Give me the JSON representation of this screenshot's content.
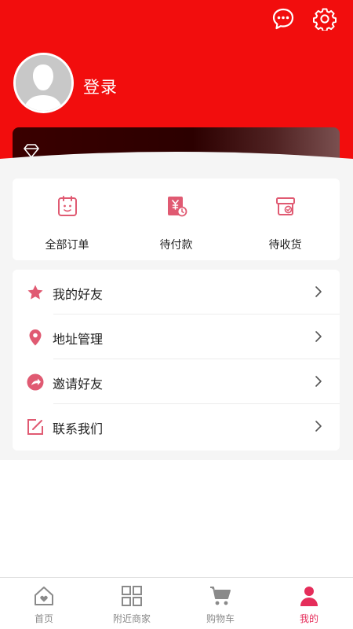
{
  "header": {
    "login_label": "登录",
    "message_icon": "chat-bubble-icon",
    "settings_icon": "gear-icon",
    "avatar_icon": "default-user-avatar"
  },
  "vip_card": {
    "icon": "diamond-icon"
  },
  "orders": [
    {
      "label": "全部订单",
      "icon": "clipboard-icon"
    },
    {
      "label": "待付款",
      "icon": "yen-bill-icon"
    },
    {
      "label": "待收货",
      "icon": "parcel-box-icon"
    }
  ],
  "menu": [
    {
      "label": "我的好友",
      "icon": "star-icon"
    },
    {
      "label": "地址管理",
      "icon": "location-pin-icon"
    },
    {
      "label": "邀请好友",
      "icon": "share-arrow-icon"
    },
    {
      "label": "联系我们",
      "icon": "edit-icon"
    }
  ],
  "tabbar": [
    {
      "label": "首页",
      "icon": "home-icon",
      "active": false
    },
    {
      "label": "附近商家",
      "icon": "grid-icon",
      "active": false
    },
    {
      "label": "购物车",
      "icon": "cart-icon",
      "active": false
    },
    {
      "label": "我的",
      "icon": "person-icon",
      "active": true
    }
  ],
  "colors": {
    "header_red": "#f20d0d",
    "icon_pink": "#e05a72",
    "active_tab": "#e52d5a",
    "inactive_tab": "#8a8a8a"
  }
}
